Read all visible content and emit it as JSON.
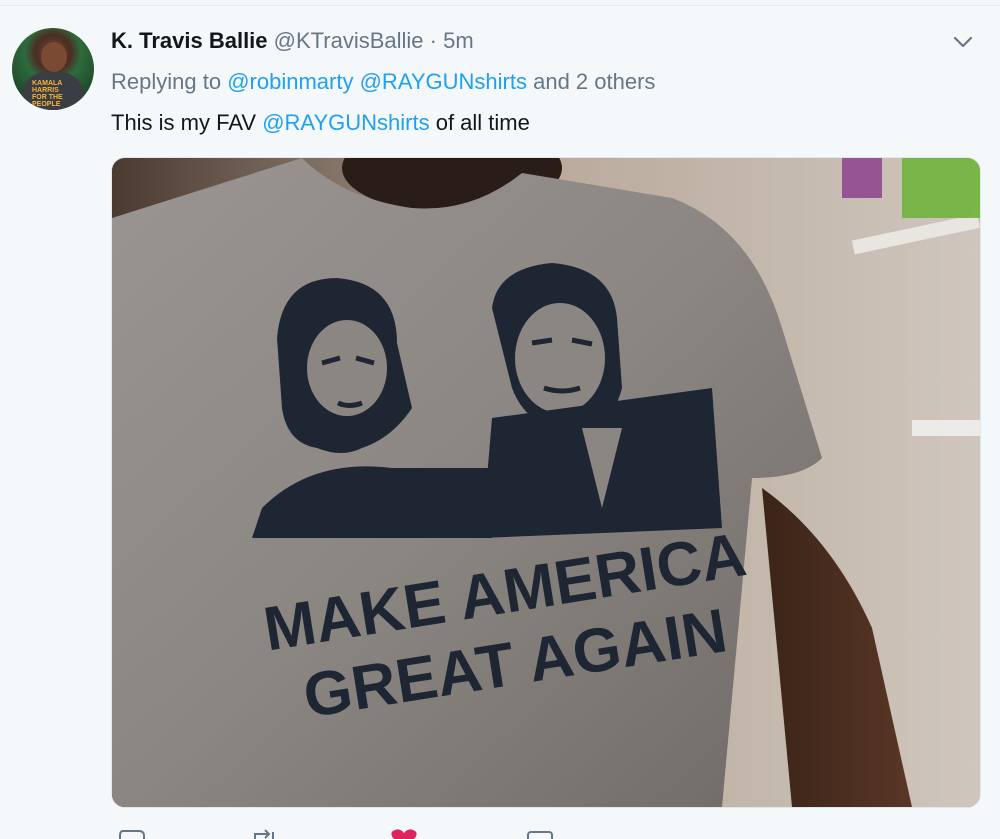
{
  "tweet": {
    "author_name": "K. Travis Ballie",
    "author_handle": "@KTravisBallie",
    "separator": "·",
    "time": "5m",
    "replying_prefix": "Replying to",
    "reply_mentions": [
      "@robinmarty",
      "@RAYGUNshirts"
    ],
    "reply_suffix": "and 2 others",
    "text_before": "This is my FAV",
    "text_mention": "@RAYGUNshirts",
    "text_after": "of all time",
    "avatar_shirt_text": "KAMALA HARRIS FOR THE PEOPLE",
    "media": {
      "shirt_line1": "MAKE AMERICA",
      "shirt_line2": "GREAT AGAIN"
    }
  },
  "icons": {
    "caret": "chevron-down-icon",
    "reply": "reply-icon",
    "retweet": "retweet-icon",
    "like": "heart-icon",
    "share": "share-icon"
  },
  "colors": {
    "background": "#f5f8fa",
    "text_primary": "#14171a",
    "text_secondary": "#657786",
    "link": "#1da1f2",
    "like": "#e0245e"
  }
}
